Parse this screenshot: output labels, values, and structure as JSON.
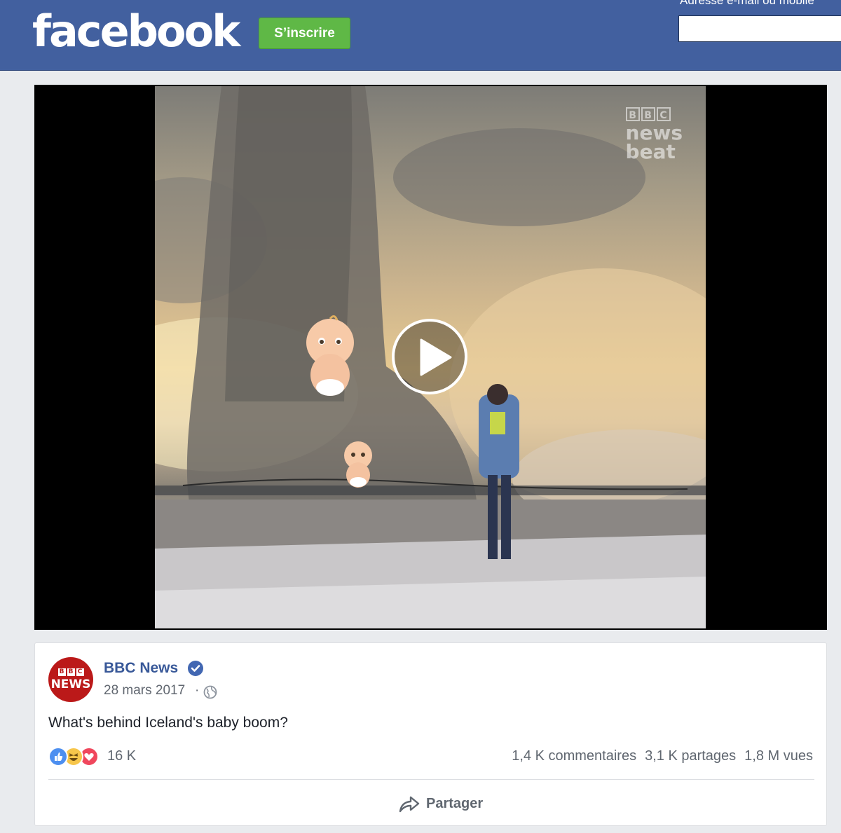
{
  "header": {
    "logo": "facebook",
    "signup_label": "S’inscrire",
    "email_label": "Adresse e-mail ou mobile",
    "email_value": "",
    "colors": {
      "bar": "#42609f",
      "signup": "#5fb846"
    }
  },
  "video": {
    "watermark_bbc": [
      "B",
      "B",
      "C"
    ],
    "watermark_line1": "news",
    "watermark_line2": "beat",
    "play_icon": "play-icon"
  },
  "post": {
    "avatar_bbc": [
      "B",
      "B",
      "C"
    ],
    "avatar_news": "NEWS",
    "page_name": "BBC News",
    "verified_icon": "verified-badge-icon",
    "date": "28 mars 2017",
    "separator": "·",
    "privacy_icon": "globe-icon",
    "text": "What's behind Iceland's baby boom?",
    "reactions": {
      "icons": [
        "like-icon",
        "haha-icon",
        "love-icon"
      ],
      "count": "16 K"
    },
    "stats": {
      "comments": "1,4 K commentaires",
      "shares": "3,1 K partages",
      "views": "1,8 M vues"
    },
    "share_label": "Partager"
  }
}
